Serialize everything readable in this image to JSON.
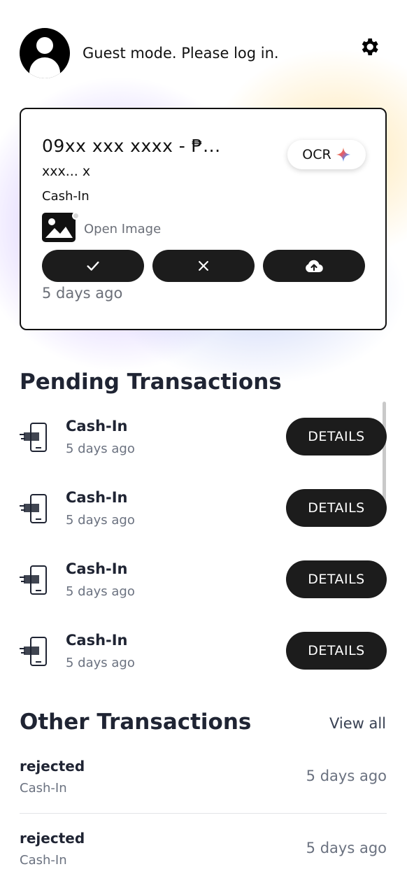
{
  "header": {
    "guest_text": "Guest mode. Please log in.",
    "avatar_icon": "user-avatar-icon",
    "settings_icon": "gear-icon"
  },
  "card": {
    "phone": "09xx xxx xxxx - ₱...",
    "name": "xxx... x",
    "type": "Cash-In",
    "ocr_label": "OCR",
    "ocr_icon": "sparkle-icon",
    "open_image_label": "Open Image",
    "actions": [
      "check-icon",
      "close-icon",
      "cloud-upload-icon"
    ],
    "time": "5 days ago"
  },
  "pending": {
    "title": "Pending Transactions",
    "items": [
      {
        "title": "Cash-In",
        "time": "5 days ago",
        "button": "DETAILS"
      },
      {
        "title": "Cash-In",
        "time": "5 days ago",
        "button": "DETAILS"
      },
      {
        "title": "Cash-In",
        "time": "5 days ago",
        "button": "DETAILS"
      },
      {
        "title": "Cash-In",
        "time": "5 days ago",
        "button": "DETAILS"
      }
    ]
  },
  "other": {
    "title": "Other Transactions",
    "view_all": "View all",
    "items": [
      {
        "status": "rejected",
        "type": "Cash-In",
        "time": "5 days ago"
      },
      {
        "status": "rejected",
        "type": "Cash-In",
        "time": "5 days ago"
      }
    ]
  },
  "colors": {
    "dark": "#1c1c1c",
    "text": "#1f2433",
    "muted": "#6b7280"
  }
}
